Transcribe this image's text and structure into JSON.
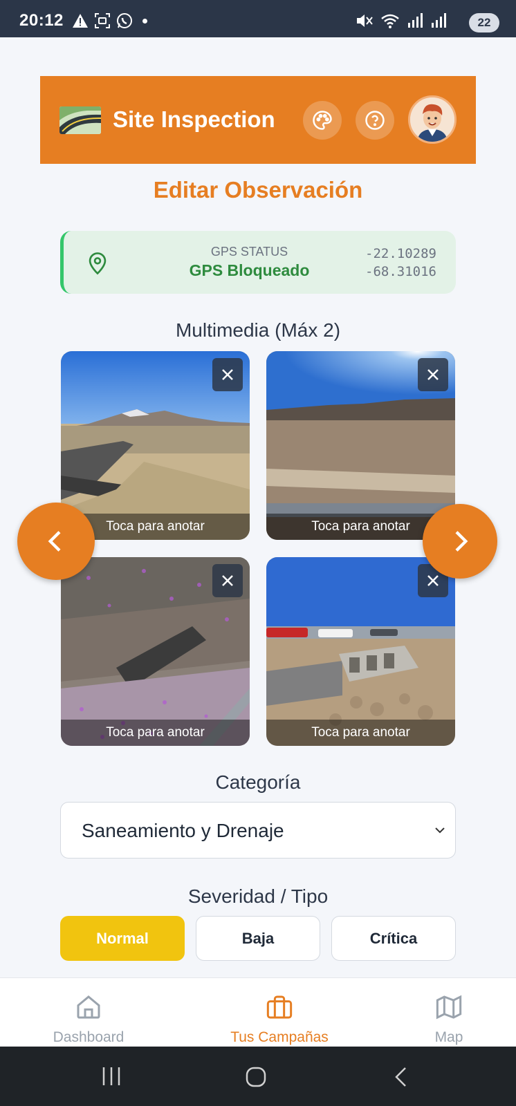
{
  "status_bar": {
    "time": "20:12",
    "battery": "22"
  },
  "header": {
    "title": "Site Inspection"
  },
  "page_title": "Editar Observación",
  "gps": {
    "label": "GPS STATUS",
    "status": "GPS Bloqueado",
    "lat": "-22.10289",
    "lon": "-68.31016"
  },
  "multimedia": {
    "title": "Multimedia (Máx 2)",
    "items": [
      {
        "caption": "Toca para anotar"
      },
      {
        "caption": "Toca para anotar"
      },
      {
        "caption": "Toca para anotar"
      },
      {
        "caption": "Toca para anotar"
      }
    ]
  },
  "categoria": {
    "title": "Categoría",
    "selected": "Saneamiento y Drenaje"
  },
  "severidad": {
    "title": "Severidad / Tipo",
    "options": [
      "Normal",
      "Baja",
      "Crítica"
    ],
    "selected": "Normal"
  },
  "bottom_nav": {
    "items": [
      {
        "label": "Dashboard",
        "icon": "home-icon"
      },
      {
        "label": "Tus Campañas",
        "icon": "briefcase-icon"
      },
      {
        "label": "Map",
        "icon": "map-icon"
      }
    ],
    "active": "Tus Campañas"
  },
  "colors": {
    "accent": "#e67e22",
    "gps_ok": "#2e8b3e",
    "normal": "#f1c40f"
  }
}
